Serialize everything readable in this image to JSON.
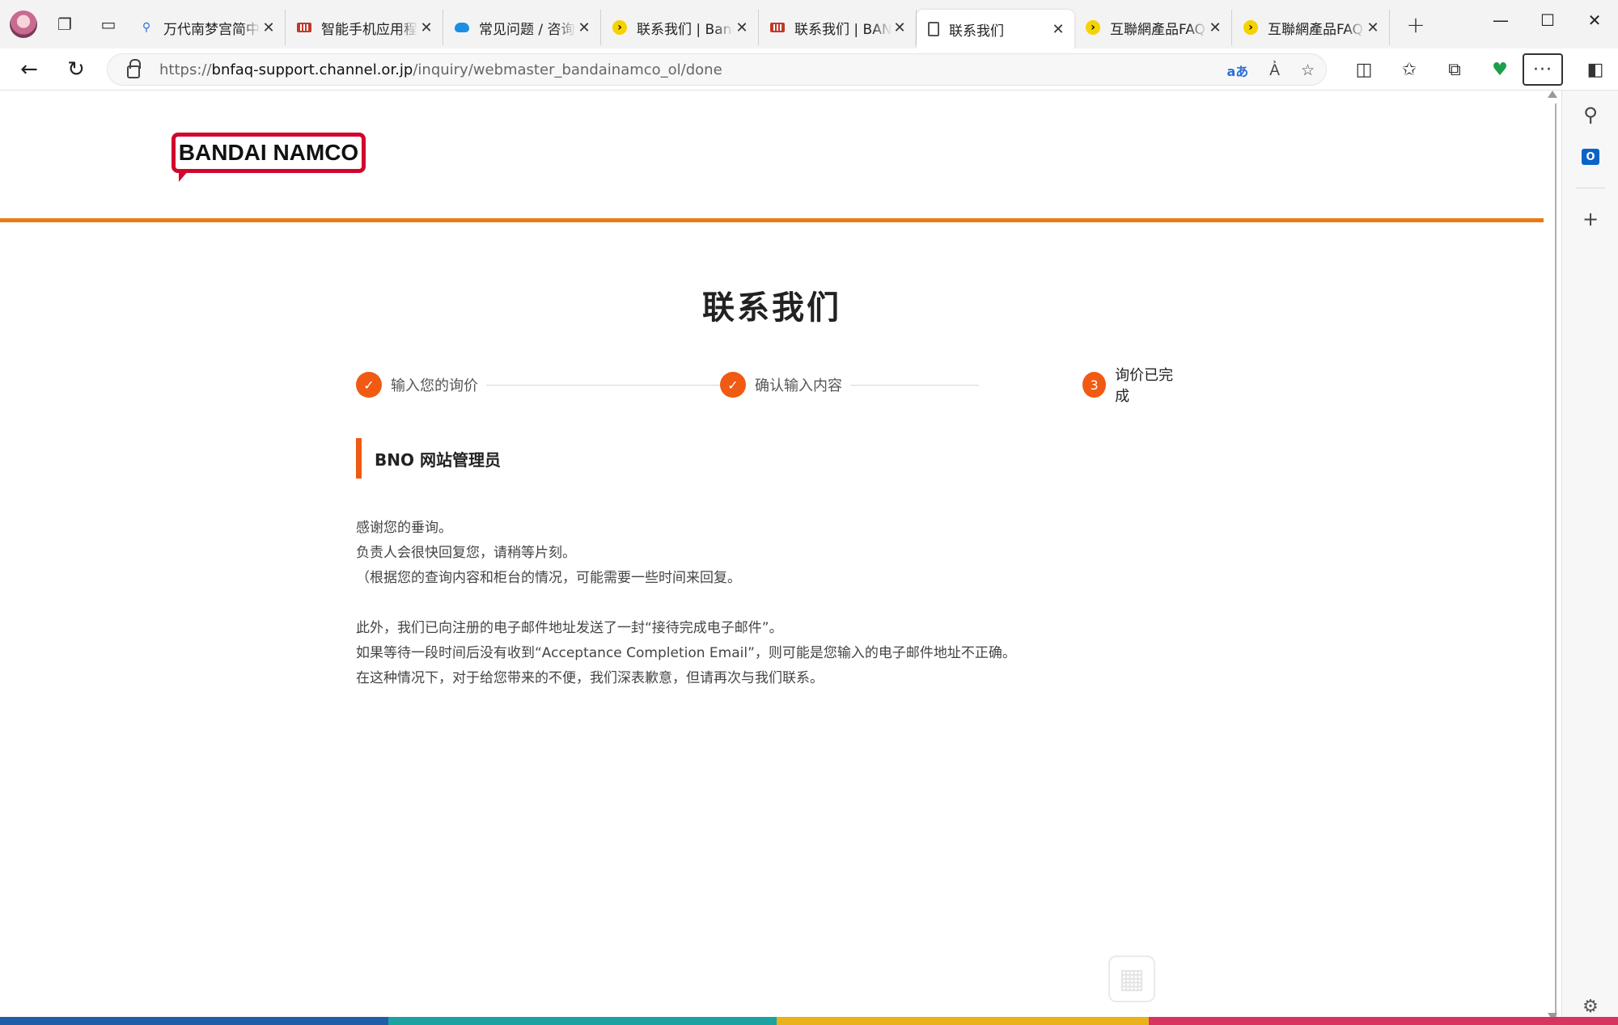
{
  "browser": {
    "tabs": [
      {
        "title": "万代南梦宫简中官方",
        "icon": "search-icon",
        "active": false
      },
      {
        "title": "智能手机应用程序",
        "icon": "keyboard-favicon",
        "active": false
      },
      {
        "title": "常见问题 / 咨询 | ",
        "icon": "cloud-favicon",
        "active": false
      },
      {
        "title": "联系我们 | Bandai",
        "icon": "pacman-favicon",
        "active": false
      },
      {
        "title": "联系我们 | BANDAI",
        "icon": "keyboard-favicon",
        "active": false
      },
      {
        "title": "联系我们",
        "icon": "page-icon",
        "active": true
      },
      {
        "title": "互聯網產品FAQ | ",
        "icon": "pacman-favicon",
        "active": false
      },
      {
        "title": "互聯網產品FAQ | ",
        "icon": "pacman-favicon",
        "active": false
      }
    ],
    "url": {
      "scheme": "https://",
      "host": "bnfaq-support.channel.or.jp",
      "path": "/inquiry/webmaster_bandainamco_ol/done"
    }
  },
  "page": {
    "logo_text": "BANDAI NAMCO",
    "title": "联系我们",
    "steps": [
      {
        "label": "输入您的询价",
        "state": "done",
        "mark": "✓"
      },
      {
        "label": "确认输入内容",
        "state": "done",
        "mark": "✓"
      },
      {
        "label": "询价已完成",
        "state": "current",
        "mark": "3"
      }
    ],
    "section_title": "BNO 网站管理员",
    "paragraphs": [
      [
        "感谢您的垂询。",
        "负责人会很快回复您，请稍等片刻。",
        "（根据您的查询内容和柜台的情况，可能需要一些时间来回复。"
      ],
      [
        "此外，我们已向注册的电子邮件地址发送了一封“接待完成电子邮件”。",
        "如果等待一段时间后没有收到“Acceptance Completion Email”，则可能是您输入的电子邮件地址不正确。",
        "在这种情况下，对于给您带来的不便，我们深表歉意，但请再次与我们联系。"
      ]
    ]
  },
  "colors": {
    "accent_orange": "#f05a12",
    "header_line": "#ea7b12",
    "logo_red": "#d1062d"
  }
}
